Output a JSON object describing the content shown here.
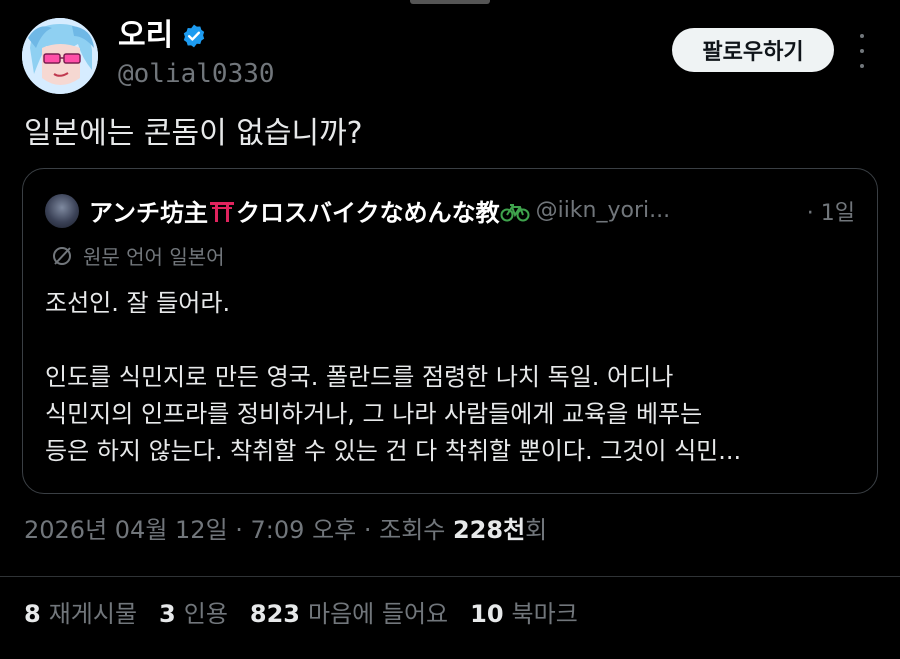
{
  "author": {
    "display_name": "오리",
    "handle": "@olial0330",
    "verified": true,
    "avatar": "anime-avatar-pink-glasses"
  },
  "follow_button": {
    "label": "팔로우하기"
  },
  "more_icon": "more-vertical-icon",
  "tweet": {
    "text": "일본에는 콘돔이 없습니까?"
  },
  "quote": {
    "author_name_part1": "アンチ坊主",
    "author_name_part2": "クロスバイクなめんな教",
    "author_handle": "@iikn_yori...",
    "time": "· 1일",
    "translation_label": "원문 언어 일본어",
    "body_line1": "조선인. 잘 들어라.",
    "body_line2": "인도를 식민지로 만든 영국. 폴란드를 점령한 나치 독일. 어디나",
    "body_line3": "식민지의 인프라를 정비하거나, 그 나라 사람들에게 교육을 베푸는",
    "body_line4": "등은 하지 않는다. 착취할 수 있는 건 다 착취할 뿐이다. 그것이 식민..."
  },
  "meta": {
    "date_time": "2026년 04월 12일 · 7:09 오후 · 조회수 ",
    "views_count": "228천",
    "views_suffix": "회"
  },
  "stats": {
    "reposts_count": "8",
    "reposts_label": "재게시물",
    "quotes_count": "3",
    "quotes_label": "인용",
    "likes_count": "823",
    "likes_label": "마음에 들어요",
    "bookmarks_count": "10",
    "bookmarks_label": "북마크"
  },
  "colors": {
    "background": "#000000",
    "text_primary": "#e7e9ea",
    "text_secondary": "#71767b",
    "verified_blue": "#1d9bf0",
    "border": "#2f3336"
  }
}
